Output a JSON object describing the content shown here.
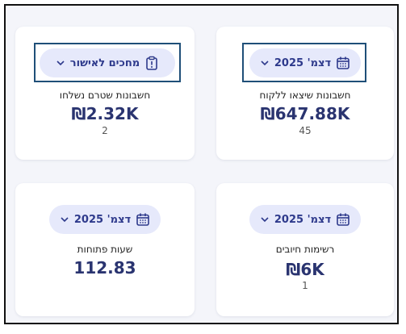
{
  "cards": [
    {
      "pill_label": "דצמ' 2025",
      "label": "חשבונות שיצאו ללקוח",
      "value": "₪647.88K",
      "count": "45"
    },
    {
      "pill_label": "מחכים לאישור",
      "label": "חשבונות שטרם נשלחו",
      "value": "₪2.32K",
      "count": "2"
    },
    {
      "pill_label": "דצמ' 2025",
      "label": "רשימות חיובים",
      "value": "₪6K",
      "count": "1"
    },
    {
      "pill_label": "דצמ' 2025",
      "label": "שעות פתוחות",
      "value": "112.83"
    }
  ],
  "colors": {
    "accent": "#2e3a8c",
    "pill_bg": "#e6e9fb",
    "highlight": "#1f4f78"
  }
}
